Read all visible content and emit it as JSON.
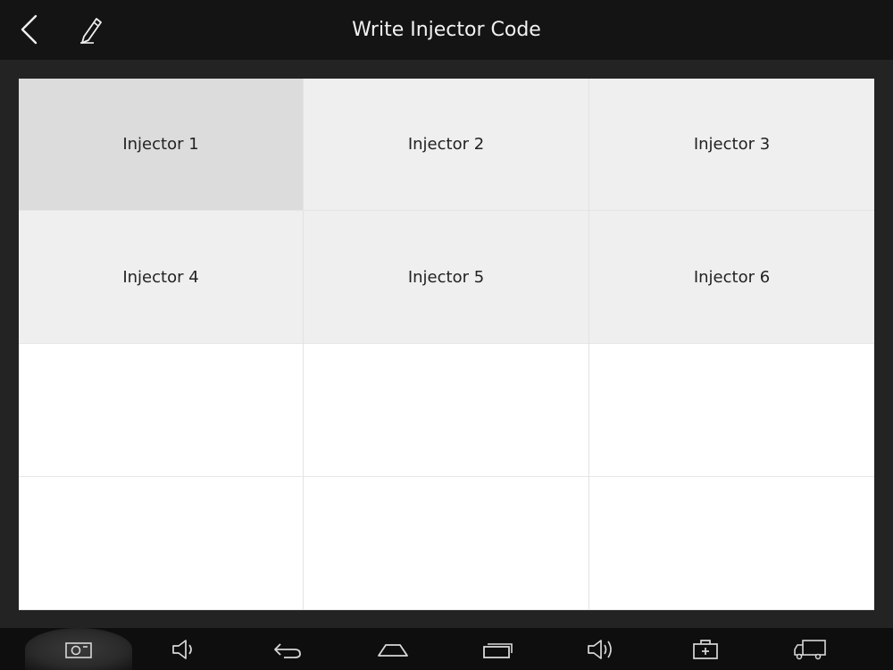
{
  "header": {
    "title": "Write Injector Code",
    "back_icon": "chevron-left-icon",
    "edit_icon": "pencil-icon"
  },
  "grid": {
    "cells": [
      {
        "label": "Injector 1",
        "state": "selected"
      },
      {
        "label": "Injector 2",
        "state": "normal"
      },
      {
        "label": "Injector 3",
        "state": "normal"
      },
      {
        "label": "Injector 4",
        "state": "normal"
      },
      {
        "label": "Injector 5",
        "state": "normal"
      },
      {
        "label": "Injector 6",
        "state": "normal"
      },
      {
        "label": "",
        "state": "empty"
      },
      {
        "label": "",
        "state": "empty"
      },
      {
        "label": "",
        "state": "empty"
      },
      {
        "label": "",
        "state": "empty"
      },
      {
        "label": "",
        "state": "empty"
      },
      {
        "label": "",
        "state": "empty"
      }
    ]
  },
  "navbar": {
    "icons": [
      "screenshot-icon",
      "volume-down-icon",
      "back-icon",
      "home-icon",
      "recent-apps-icon",
      "volume-up-icon",
      "toolbox-icon",
      "truck-icon"
    ]
  },
  "colors": {
    "topbar": "#141414",
    "panel_bg": "#ffffff",
    "cell_filled": "#efefef",
    "cell_selected": "#dcdcdc",
    "navbar": "#0e0e0e"
  }
}
